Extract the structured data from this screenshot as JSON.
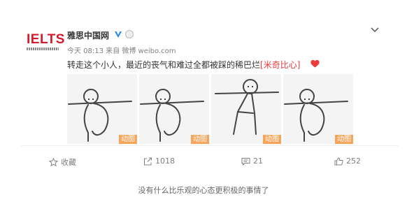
{
  "post": {
    "logo_text": "IELTS",
    "username": "雅思中国网",
    "meta": "今天 08:13 来自 微博 weibo.com",
    "text": "转走这个小人，最近的丧气和难过全都被踩的稀巴烂",
    "emoji_text": "[米奇比心]",
    "images": [
      {
        "tag": "动图"
      },
      {
        "tag": "动图"
      },
      {
        "tag": "动图"
      },
      {
        "tag": "动图"
      }
    ]
  },
  "actions": {
    "favorite": "收藏",
    "repost": "1018",
    "comment": "21",
    "like": "252"
  },
  "footer_text": "没有什么比乐观的心态更积极的事情了",
  "colors": {
    "logo_red": "#d7192b",
    "gif_tag": "#f7a55a",
    "verified_blue": "#1e88e5",
    "heart": "#eb3b3b"
  }
}
